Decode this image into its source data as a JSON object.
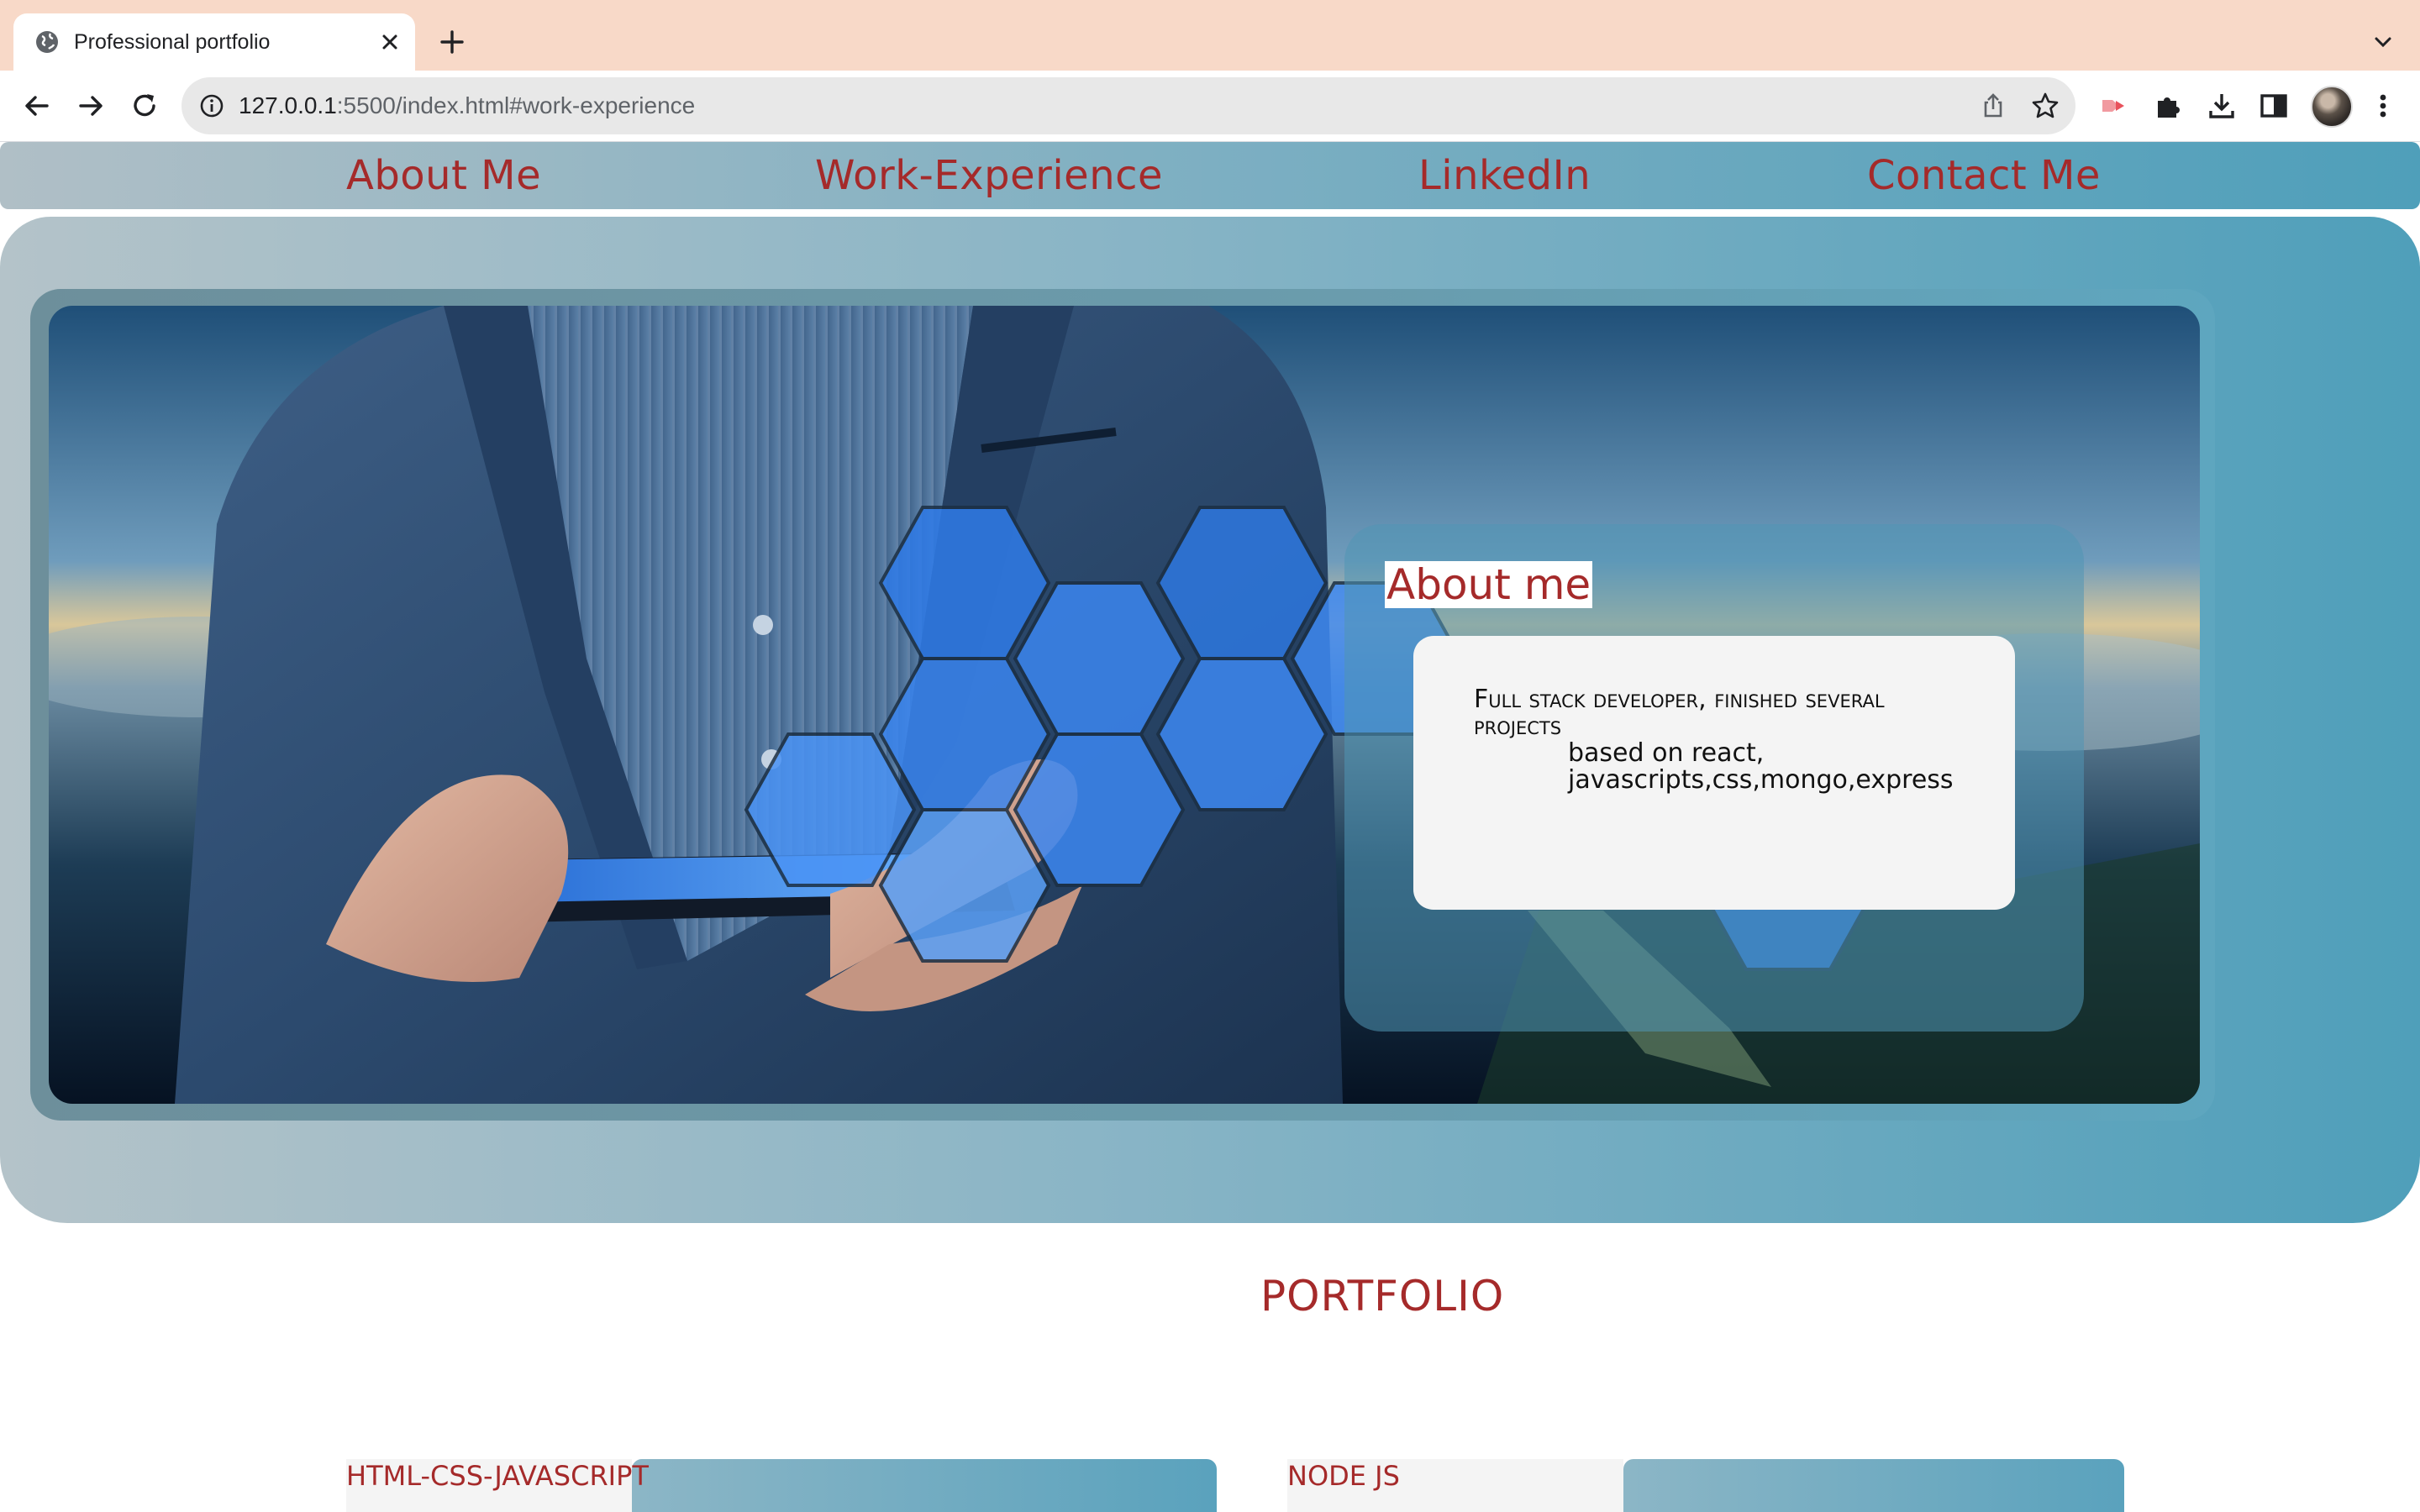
{
  "browser": {
    "tab_title": "Professional portfolio",
    "url_host": "127.0.0.1",
    "url_rest": ":5500/index.html#work-experience"
  },
  "nav": {
    "items": [
      {
        "label": "About Me"
      },
      {
        "label": "Work-Experience"
      },
      {
        "label": "LinkedIn"
      },
      {
        "label": "Contact Me"
      }
    ]
  },
  "about": {
    "title": "About me",
    "lead": "Full stack developer, finished several projects",
    "rest_line1": "based on react,",
    "rest_line2": "javascripts,css,mongo,express"
  },
  "portfolio": {
    "title": "PORTFOLIO",
    "projects": [
      {
        "label": "HTML-CSS-JAVASCRIPT"
      },
      {
        "label": "NODE JS"
      }
    ]
  },
  "colors": {
    "accent": "#a52a2a",
    "tab_strip": "#f8d9c8"
  }
}
